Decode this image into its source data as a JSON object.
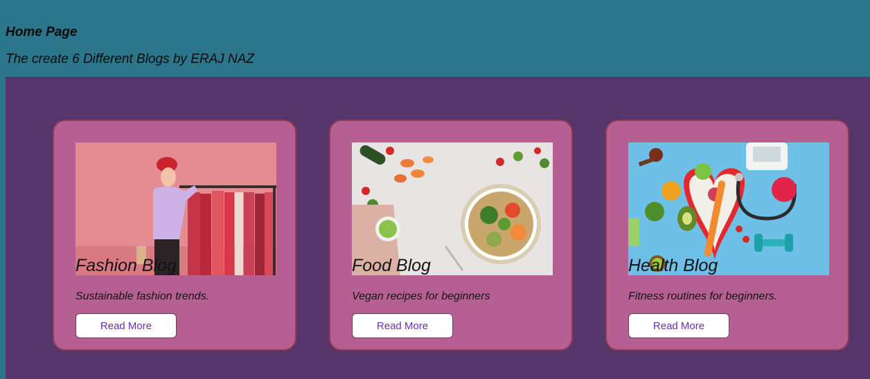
{
  "header": {
    "title": "Home Page",
    "subtitle": "The create 6 Different Blogs by ERAJ NAZ"
  },
  "blogs": [
    {
      "title": "Fashion Blog",
      "description": "Sustainable fashion trends.",
      "button_label": "Read More",
      "image_icon": "fashion-photo"
    },
    {
      "title": "Food Blog",
      "description": "Vegan recipes for beginners",
      "button_label": "Read More",
      "image_icon": "food-photo"
    },
    {
      "title": "Health Blog",
      "description": "Fitness routines for beginners.",
      "button_label": "Read More",
      "image_icon": "health-photo"
    }
  ],
  "colors": {
    "header_bg": "#2c768b",
    "section_bg": "#56356b",
    "card_bg": "#b65f92",
    "card_border": "#8e3b55",
    "button_text": "#6a2fb0"
  }
}
